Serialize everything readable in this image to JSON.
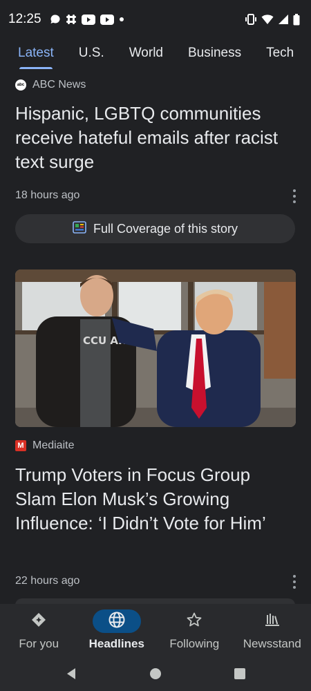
{
  "status_bar": {
    "time": "12:25",
    "left_icons": [
      "chat-bubble-icon",
      "slack-icon",
      "youtube-icon",
      "youtube-icon",
      "dot-icon"
    ],
    "right_icons": [
      "vibrate-icon",
      "wifi-icon",
      "signal-icon",
      "battery-icon"
    ]
  },
  "tabs": [
    {
      "label": "Latest",
      "active": true
    },
    {
      "label": "U.S.",
      "active": false
    },
    {
      "label": "World",
      "active": false
    },
    {
      "label": "Business",
      "active": false
    },
    {
      "label": "Tech",
      "active": false
    }
  ],
  "articles": [
    {
      "source": "ABC News",
      "source_logo_text": "abc",
      "headline": "Hispanic, LGBTQ communities receive hateful emails after racist text surge",
      "time": "18 hours ago",
      "coverage_label": "Full Coverage of this story"
    },
    {
      "source": "Mediaite",
      "source_logo_text": "M",
      "shirt_text": "CCU ARS",
      "headline": "Trump Voters in Focus Group Slam Elon Musk’s Growing Influence: ‘I Didn’t Vote for Him’",
      "time": "22 hours ago"
    }
  ],
  "bottom_nav": [
    {
      "label": "For you",
      "icon": "for-you-icon",
      "active": false
    },
    {
      "label": "Headlines",
      "icon": "globe-icon",
      "active": true
    },
    {
      "label": "Following",
      "icon": "star-icon",
      "active": false
    },
    {
      "label": "Newsstand",
      "icon": "newsstand-icon",
      "active": false
    }
  ],
  "colors": {
    "background": "#202124",
    "accent": "#8ab4f8",
    "active_nav_pill": "#0b4f87"
  }
}
